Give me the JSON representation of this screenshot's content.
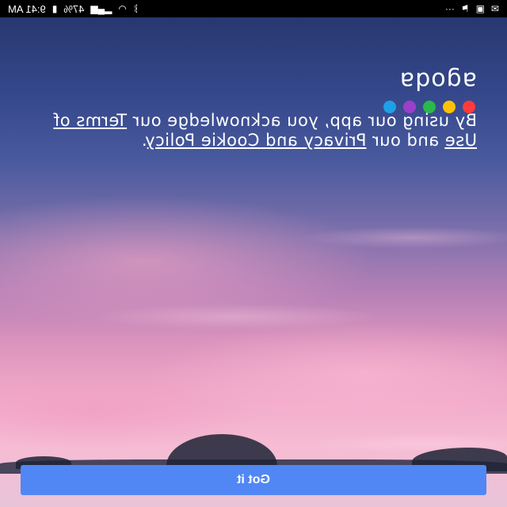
{
  "status_bar": {
    "time": "9:41 AM",
    "battery": "47%",
    "icons": [
      "bluetooth-icon",
      "wifi-icon",
      "signal-icon",
      "battery-icon",
      "alarm-icon",
      "gallery-icon",
      "mail-icon",
      "more-icon"
    ]
  },
  "logo": {
    "text": "agoda",
    "dot_colors": [
      "#ff3b3b",
      "#ffc107",
      "#2bb94a",
      "#9b3fcc",
      "#1da1e6"
    ]
  },
  "consent": {
    "prefix": "By using our app, you acknowledge our ",
    "terms_link": "Terms of Use",
    "middle": " and our ",
    "privacy_link": "Privacy and Cookie Policy",
    "suffix": "."
  },
  "button": {
    "label": "Got it",
    "color": "#5187f4"
  }
}
